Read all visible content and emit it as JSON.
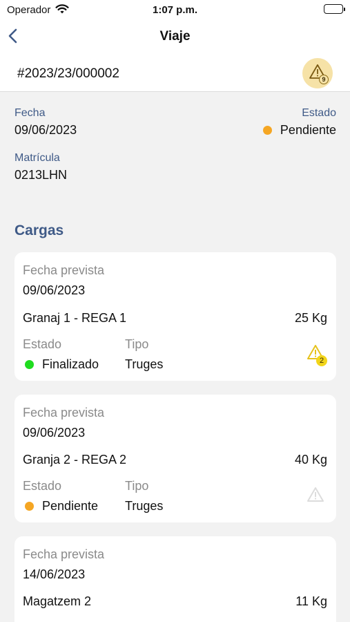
{
  "status_bar": {
    "carrier": "Operador",
    "time": "1:07 p.m."
  },
  "navbar": {
    "title": "Viaje"
  },
  "trip": {
    "code": "#2023/23/000002",
    "alert_count": "9",
    "fecha_label": "Fecha",
    "fecha": "09/06/2023",
    "estado_label": "Estado",
    "estado": "Pendiente",
    "estado_color": "#f5a623",
    "matricula_label": "Matrícula",
    "matricula": "0213LHN"
  },
  "section": {
    "title": "Cargas"
  },
  "cargas": [
    {
      "fecha_label": "Fecha prevista",
      "fecha": "09/06/2023",
      "location": "Granaj 1 - REGA 1",
      "weight": "25 Kg",
      "estado_label": "Estado",
      "estado": "Finalizado",
      "estado_color": "#1fdc1f",
      "tipo_label": "Tipo",
      "tipo": "Truges",
      "alert_count": "2",
      "alert_color": "#e6c21b"
    },
    {
      "fecha_label": "Fecha prevista",
      "fecha": "09/06/2023",
      "location": "Granja 2 - REGA 2",
      "weight": "40 Kg",
      "estado_label": "Estado",
      "estado": "Pendiente",
      "estado_color": "#f5a623",
      "tipo_label": "Tipo",
      "tipo": "Truges",
      "alert_color": "#dcdcdc"
    },
    {
      "fecha_label": "Fecha prevista",
      "fecha": "14/06/2023",
      "location": "Magatzem 2",
      "weight": "11 Kg"
    }
  ]
}
